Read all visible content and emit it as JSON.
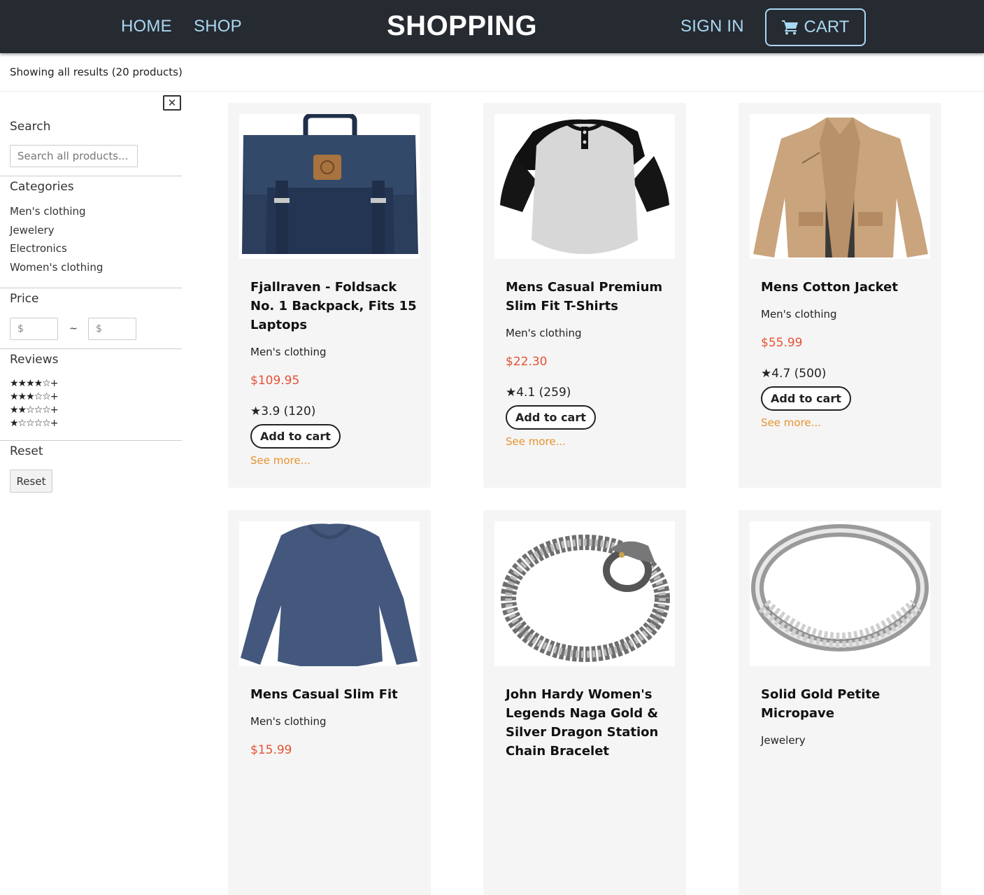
{
  "header": {
    "nav": [
      "HOME",
      "SHOP"
    ],
    "brand": "SHOPPING",
    "sign_in": "SIGN IN",
    "cart_label": "CART",
    "colors": {
      "bar": "#262a31",
      "link": "#a9d8f2"
    }
  },
  "results_text": "Showing all results (20 products)",
  "sidebar": {
    "close_icon": "close-icon",
    "search": {
      "title": "Search",
      "placeholder": "Search all products..."
    },
    "categories": {
      "title": "Categories",
      "items": [
        "Men's clothing",
        "Jewelery",
        "Electronics",
        "Women's clothing"
      ]
    },
    "price": {
      "title": "Price",
      "min_placeholder": "$",
      "separator": "~",
      "max_placeholder": "$"
    },
    "reviews": {
      "title": "Reviews",
      "rows": [
        "★★★★☆+",
        "★★★☆☆+",
        "★★☆☆☆+",
        "★☆☆☆☆+"
      ]
    },
    "reset": {
      "title": "Reset",
      "button": "Reset"
    }
  },
  "products": [
    {
      "title": "Fjallraven - Foldsack No. 1 Backpack, Fits 15 Laptops",
      "category": "Men's clothing",
      "price": "$109.95",
      "rating": "★3.9 (120)",
      "add": "Add to cart",
      "see_more": "See more...",
      "image": "backpack"
    },
    {
      "title": "Mens Casual Premium Slim Fit T-Shirts",
      "category": "Men's clothing",
      "price": "$22.30",
      "rating": "★4.1 (259)",
      "add": "Add to cart",
      "see_more": "See more...",
      "image": "raglan-tshirt"
    },
    {
      "title": "Mens Cotton Jacket",
      "category": "Men's clothing",
      "price": "$55.99",
      "rating": "★4.7 (500)",
      "add": "Add to cart",
      "see_more": "See more...",
      "image": "jacket"
    },
    {
      "title": "Mens Casual Slim Fit",
      "category": "Men's clothing",
      "price": "$15.99",
      "image": "long-sleeve-shirt"
    },
    {
      "title": "John Hardy Women's Legends Naga Gold & Silver Dragon Station Chain Bracelet",
      "category": "",
      "price": "",
      "image": "dragon-bracelet"
    },
    {
      "title": "Solid Gold Petite Micropave",
      "category": "Jewelery",
      "price": "",
      "image": "ring"
    }
  ],
  "colors": {
    "price": "#e55234",
    "see_more": "#e8922e",
    "card": "#f5f5f5"
  }
}
